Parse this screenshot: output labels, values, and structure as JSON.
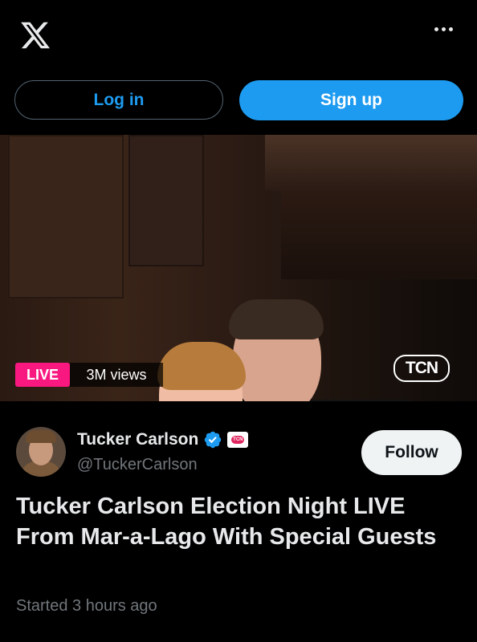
{
  "header": {
    "logo_icon": "x-logo-icon",
    "more_icon": "more-dots-icon"
  },
  "auth": {
    "login_label": "Log in",
    "signup_label": "Sign up",
    "accent_color": "#1d9bf0"
  },
  "video": {
    "live_label": "LIVE",
    "views_label": "3M views",
    "watermark": "TCN",
    "live_color": "#f91880"
  },
  "author": {
    "name": "Tucker Carlson",
    "handle": "@TuckerCarlson",
    "verified_icon": "verified-badge-icon",
    "affiliate_badge": "TCN",
    "follow_label": "Follow"
  },
  "broadcast": {
    "title": "Tucker Carlson Election Night LIVE From Mar-a-Lago With Special Guests",
    "started": "Started 3 hours ago"
  }
}
